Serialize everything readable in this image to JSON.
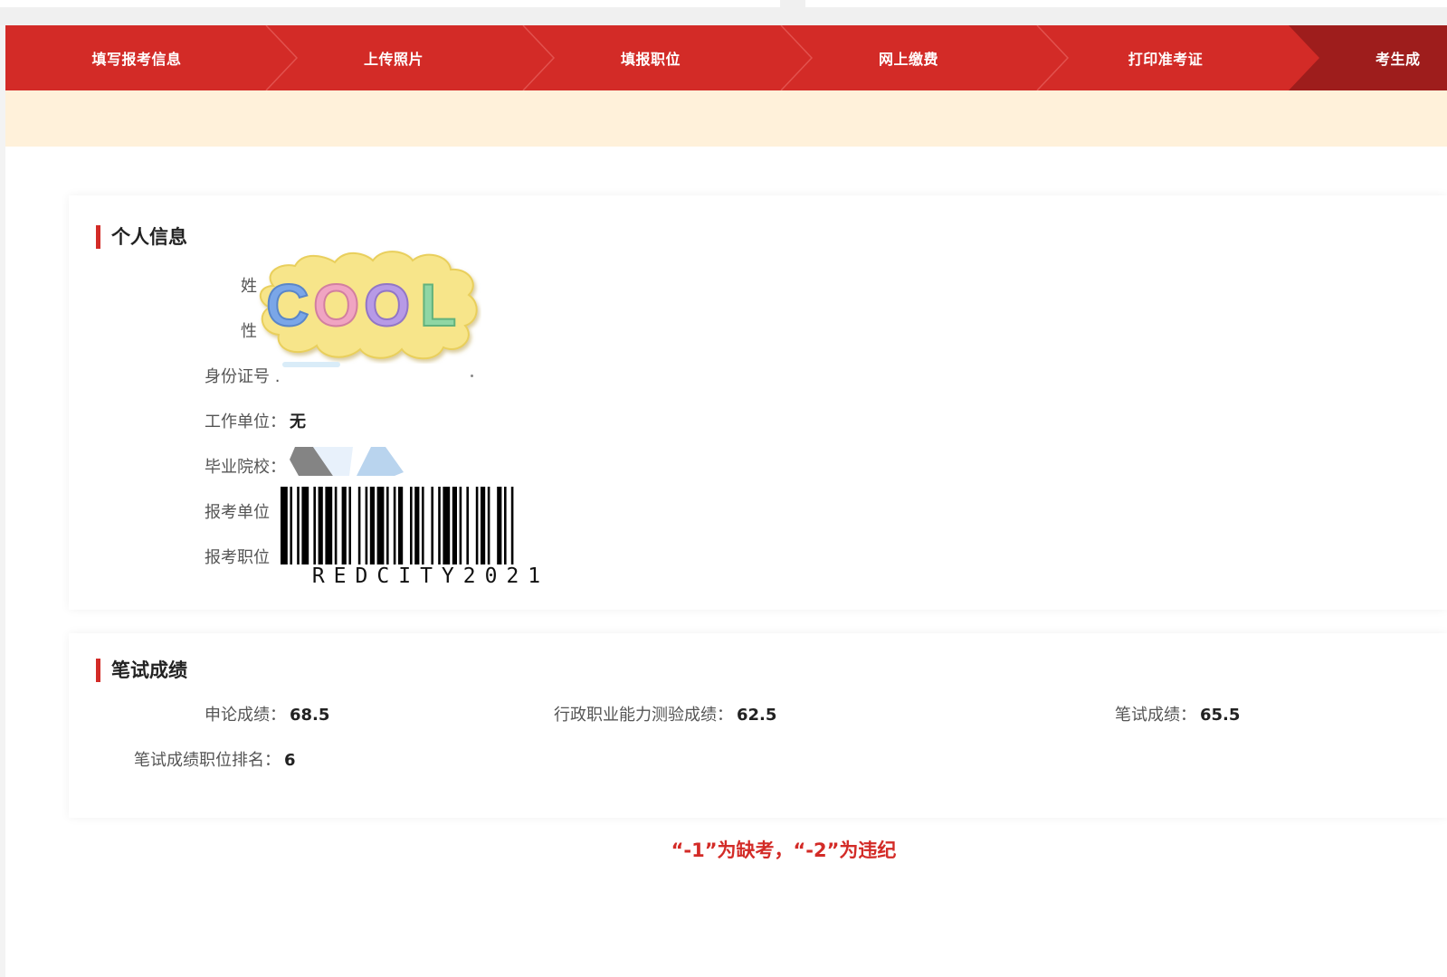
{
  "steps": [
    {
      "label": "填写报考信息"
    },
    {
      "label": "上传照片"
    },
    {
      "label": "填报职位"
    },
    {
      "label": "网上缴费"
    },
    {
      "label": "打印准考证"
    },
    {
      "label": "考生成"
    }
  ],
  "personal": {
    "title": "个人信息",
    "name_label": "姓",
    "gender_label": "性",
    "id_label": "身份证号",
    "employer_label": "工作单位：",
    "employer_value": "无",
    "school_label": "毕业院校：",
    "apply_unit_label": "报考单位",
    "apply_position_label": "报考职位",
    "sticker_text": "COOL",
    "barcode_text": "REDCITY2021"
  },
  "scores": {
    "title": "笔试成绩",
    "shenlun_label": "申论成绩：",
    "shenlun_value": "68.5",
    "xingce_label": "行政职业能力测验成绩：",
    "xingce_value": "62.5",
    "written_label": "笔试成绩：",
    "written_value": "65.5",
    "rank_label": "笔试成绩职位排名：",
    "rank_value": "6"
  },
  "note": "“-1”为缺考，“-2”为违纪",
  "colors": {
    "accent": "#d32b27",
    "accent_dark": "#9e1d1c",
    "notice_bg": "#fff1da"
  }
}
